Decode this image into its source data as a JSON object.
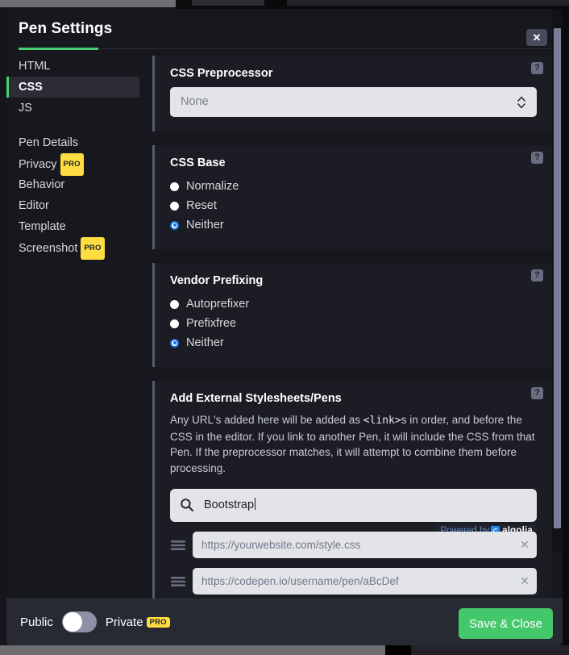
{
  "header": {
    "title": "Pen Settings",
    "close_label": "✕"
  },
  "sidebar": {
    "primary": [
      {
        "label": "HTML",
        "active": false
      },
      {
        "label": "CSS",
        "active": true
      },
      {
        "label": "JS",
        "active": false
      }
    ],
    "secondary": [
      {
        "label": "Pen Details",
        "pro": ""
      },
      {
        "label": "Privacy",
        "pro": "PRO"
      },
      {
        "label": "Behavior",
        "pro": ""
      },
      {
        "label": "Editor",
        "pro": ""
      },
      {
        "label": "Template",
        "pro": ""
      },
      {
        "label": "Screenshot",
        "pro": "PRO"
      }
    ]
  },
  "preprocessor": {
    "title": "CSS Preprocessor",
    "value": "None",
    "help": "?"
  },
  "css_base": {
    "title": "CSS Base",
    "help": "?",
    "options": [
      {
        "label": "Normalize",
        "checked": false
      },
      {
        "label": "Reset",
        "checked": false
      },
      {
        "label": "Neither",
        "checked": true
      }
    ]
  },
  "vendor_prefixing": {
    "title": "Vendor Prefixing",
    "help": "?",
    "options": [
      {
        "label": "Autoprefixer",
        "checked": false
      },
      {
        "label": "Prefixfree",
        "checked": false
      },
      {
        "label": "Neither",
        "checked": true
      }
    ]
  },
  "external": {
    "title": "Add External Stylesheets/Pens",
    "help": "?",
    "desc_1": "Any URL's added here will be added as ",
    "desc_code": "<link>",
    "desc_2": "s in order, and before the CSS in the editor. If you link to another Pen, it will include the CSS from that Pen. If the preprocessor matches, it will attempt to combine them before processing.",
    "search_value": "Bootstrap",
    "search_icon": "search-icon",
    "algolia_prefix": "Powered by",
    "algolia_name": "algolia",
    "rows": [
      {
        "placeholder": "https://yourwebsite.com/style.css",
        "remove": "✕"
      },
      {
        "placeholder": "https://codepen.io/username/pen/aBcDef",
        "remove": "✕"
      }
    ]
  },
  "footer": {
    "public_label": "Public",
    "private_label": "Private",
    "private_pro": "PRO",
    "save_label": "Save & Close"
  },
  "colors": {
    "accent_green": "#47cf73",
    "pro_yellow": "#ffdd40",
    "radio_blue": "#1673e6",
    "save_green": "#45c86c"
  }
}
